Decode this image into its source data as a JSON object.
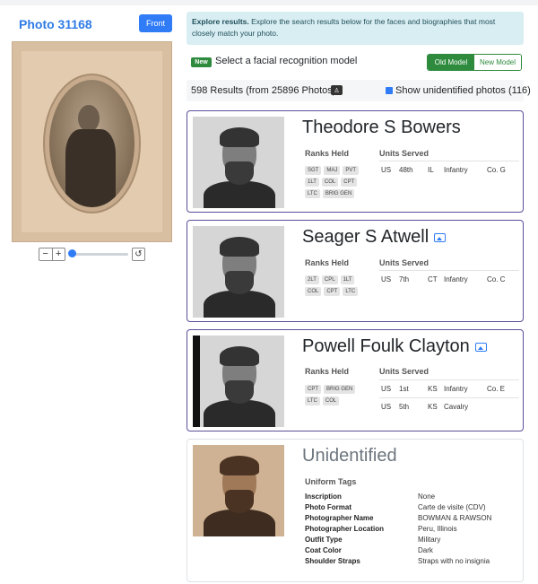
{
  "photo": {
    "title": "Photo 31168",
    "front_button": "Front"
  },
  "zoom": {
    "minus": "−",
    "plus": "+",
    "reset": "↺"
  },
  "alert": {
    "bold": "Explore results.",
    "text": " Explore the search results below for the faces and biographies that most closely match your photo."
  },
  "model": {
    "badge": "New",
    "label": "Select a facial recognition model",
    "old": "Old Model",
    "new": "New Model"
  },
  "results": {
    "count_text": "598 Results (from 25896 Photos)",
    "pdf_icon": "♙",
    "unidentified_label": "Show unidentified photos (116)"
  },
  "headers": {
    "ranks": "Ranks Held",
    "units": "Units Served",
    "uniform": "Uniform Tags"
  },
  "cards": [
    {
      "name": "Theodore S Bowers",
      "ranks": [
        "SGT",
        "MAJ",
        "PVT",
        "1LT",
        "COL",
        "CPT",
        "LTC",
        "BRIG GEN"
      ],
      "units": [
        {
          "country": "US",
          "num": "48th",
          "state": "IL",
          "branch": "Infantry",
          "co": "Co. G"
        }
      ]
    },
    {
      "name": "Seager S Atwell",
      "ranks": [
        "2LT",
        "CPL",
        "1LT",
        "COL",
        "CPT",
        "LTC"
      ],
      "units": [
        {
          "country": "US",
          "num": "7th",
          "state": "CT",
          "branch": "Infantry",
          "co": "Co. C"
        }
      ]
    },
    {
      "name": "Powell Foulk Clayton",
      "ranks": [
        "CPT",
        "BRIG GEN",
        "LTC",
        "COL"
      ],
      "units": [
        {
          "country": "US",
          "num": "1st",
          "state": "KS",
          "branch": "Infantry",
          "co": "Co. E"
        },
        {
          "country": "US",
          "num": "5th",
          "state": "KS",
          "branch": "Cavalry",
          "co": ""
        }
      ]
    }
  ],
  "unidentified": {
    "name": "Unidentified",
    "tags": [
      {
        "k": "Inscription",
        "v": "None"
      },
      {
        "k": "Photo Format",
        "v": "Carte de visite (CDV)"
      },
      {
        "k": "Photographer Name",
        "v": "BOWMAN & RAWSON"
      },
      {
        "k": "Photographer Location",
        "v": "Peru, Illinois"
      },
      {
        "k": "Outfit Type",
        "v": "Military"
      },
      {
        "k": "Coat Color",
        "v": "Dark"
      },
      {
        "k": "Shoulder Straps",
        "v": "Straps with no insignia"
      }
    ]
  }
}
